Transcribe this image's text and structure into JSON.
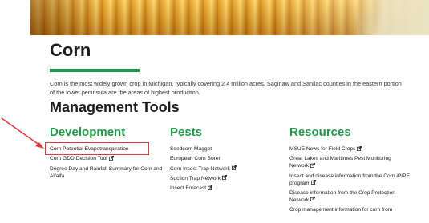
{
  "page": {
    "title": "Corn",
    "intro": "Corn is the most widely grown crop in Michigan, typically covering 2.4 million acres. Saginaw and Sanilac counties in the eastern portion of the lower peninsula are the areas of highest production.",
    "section_title": "Management Tools"
  },
  "columns": [
    {
      "heading": "Development",
      "items": [
        {
          "label": "Corn Potential Evapotranspiration",
          "external": false
        },
        {
          "label": "Corn GDD Decision Tool",
          "external": true
        },
        {
          "label": "Degree Day and Rainfall Summary for Corn and Alfalfa",
          "external": false
        }
      ]
    },
    {
      "heading": "Pests",
      "items": [
        {
          "label": "Seedcorn Maggot",
          "external": false
        },
        {
          "label": "European Corn Borer",
          "external": false
        },
        {
          "label": "Corn Insect Trap Network",
          "external": true
        },
        {
          "label": "Suction Trap Network",
          "external": true
        },
        {
          "label": "Insect Forecast",
          "external": true
        }
      ]
    },
    {
      "heading": "Resources",
      "items": [
        {
          "label": "MSUE News for Field Crops",
          "external": true
        },
        {
          "label": "Great Lakes and Maritimes Pest Monitoring Network",
          "external": true
        },
        {
          "label": "Insect and disease information from the Corn iPIPE program",
          "external": true
        },
        {
          "label": "Disease information from the Crop Protection Network",
          "external": true
        },
        {
          "label": "Crop management information for corn from",
          "external": false
        }
      ]
    }
  ],
  "colors": {
    "accent": "#1f9a47",
    "highlight": "#e23636"
  },
  "icons": {
    "external_link": "external-link-icon"
  }
}
